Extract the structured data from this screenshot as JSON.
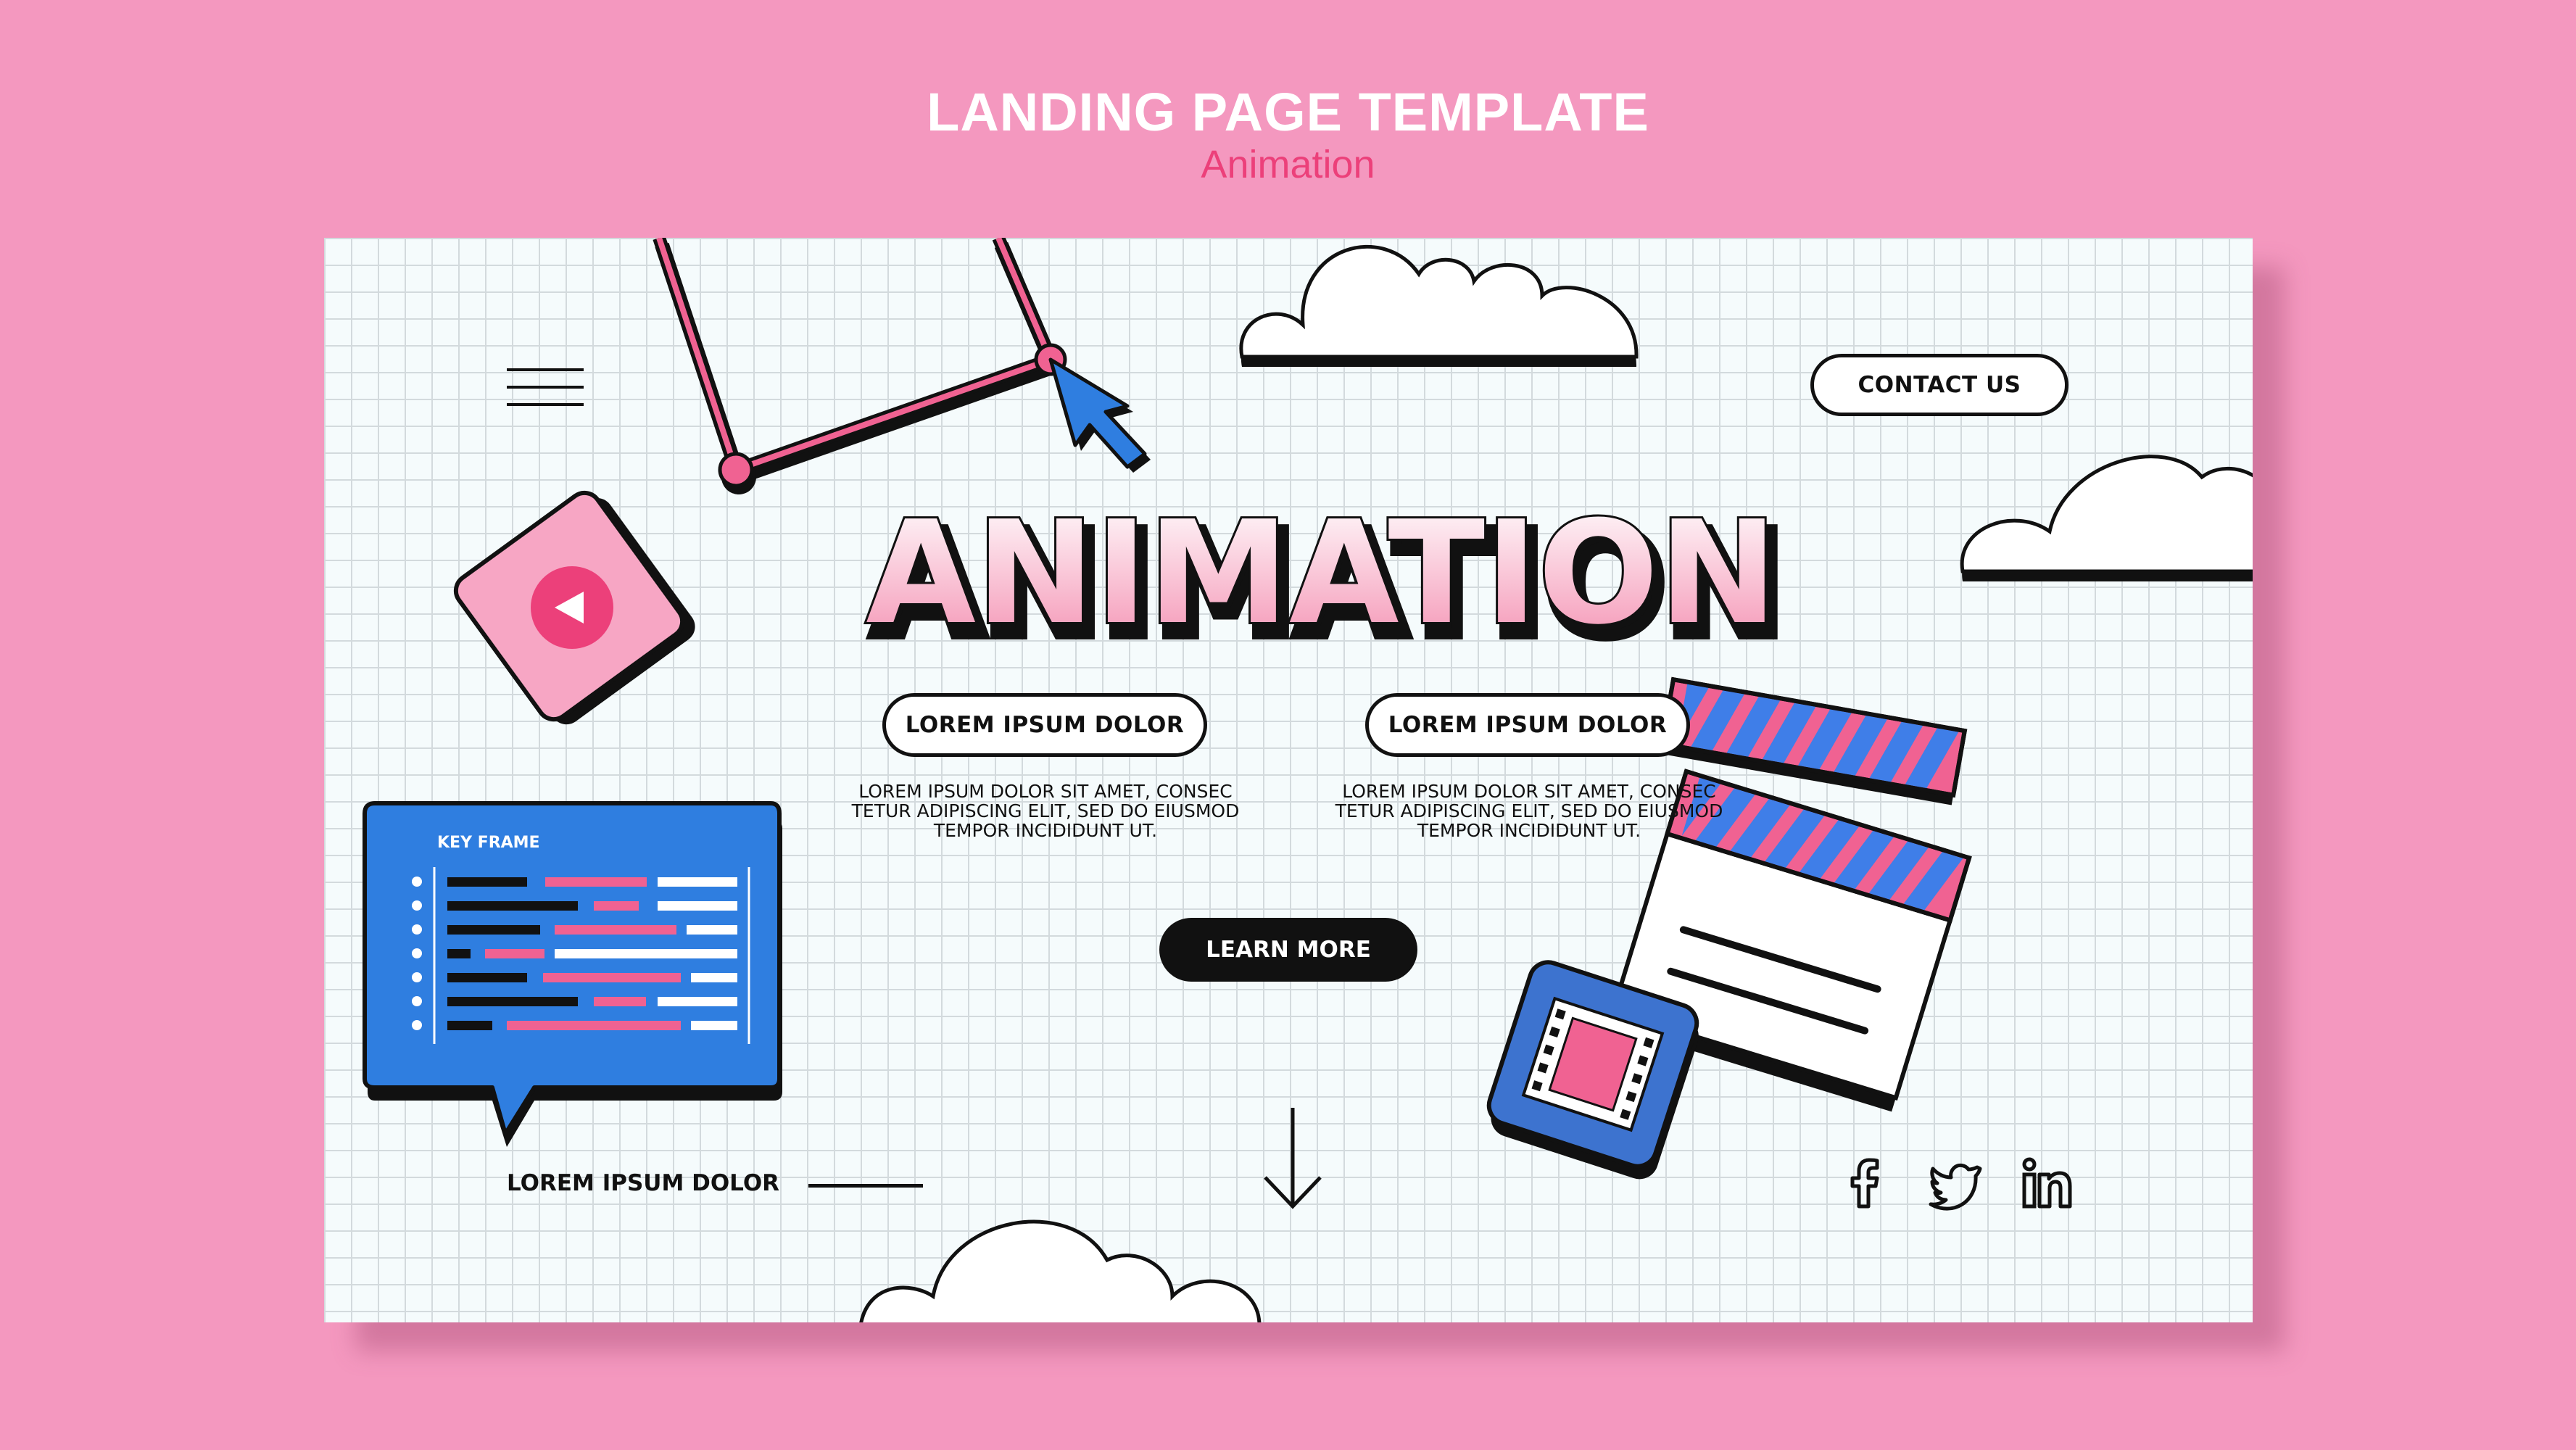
{
  "header": {
    "title": "LANDING PAGE TEMPLATE",
    "subtitle": "Animation"
  },
  "colors": {
    "background": "#f498bf",
    "accent_pink": "#ec407a",
    "light_pink": "#f48fb1",
    "blue": "#2f7ee0",
    "ink": "#111111",
    "grid": "#f5fbfc"
  },
  "nav": {
    "menu_icon": "hamburger-menu-icon",
    "contact_label": "CONTACT US"
  },
  "hero": {
    "title": "ANIMATION",
    "columns": [
      {
        "heading": "LOREM IPSUM DOLOR",
        "lines": [
          "LOREM IPSUM DOLOR SIT AMET, CONSEC",
          "TETUR ADIPISCING ELIT, SED DO EIUSMOD",
          "TEMPOR INCIDIDUNT UT."
        ]
      },
      {
        "heading": "LOREM IPSUM DOLOR",
        "lines": [
          "LOREM IPSUM DOLOR SIT AMET, CONSEC",
          "TETUR ADIPISCING ELIT, SED DO EIUSMOD",
          "TEMPOR INCIDIDUNT UT."
        ]
      }
    ],
    "cta_label": "LEARN MORE"
  },
  "keyframe_panel": {
    "label": "KEY FRAME"
  },
  "footer": {
    "label": "LOREM IPSUM DOLOR",
    "social": [
      "facebook-icon",
      "twitter-icon",
      "linkedin-icon"
    ]
  },
  "decorations": [
    "cloud",
    "motion-path",
    "cursor-arrow",
    "play-button-tile",
    "clapperboard",
    "film-strip-tile",
    "scroll-down-arrow"
  ]
}
